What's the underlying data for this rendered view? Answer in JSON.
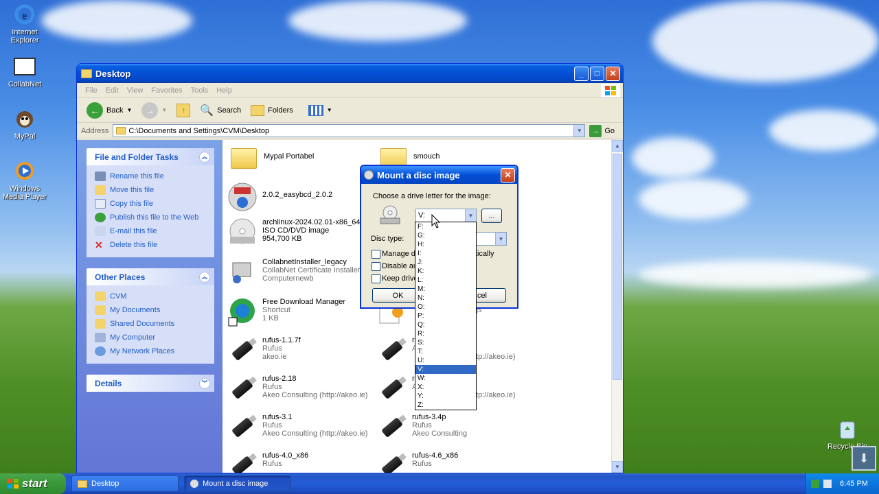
{
  "desktop": {
    "icons": [
      {
        "label": "Internet Explorer"
      },
      {
        "label": "CollabNet"
      },
      {
        "label": "MyPal"
      },
      {
        "label": "Windows Media Player"
      },
      {
        "label": "Recycle Bin"
      }
    ]
  },
  "window": {
    "title": "Desktop",
    "menu": [
      "File",
      "Edit",
      "View",
      "Favorites",
      "Tools",
      "Help"
    ],
    "toolbar": {
      "back": "Back",
      "search": "Search",
      "folders": "Folders"
    },
    "address": {
      "label": "Address",
      "value": "C:\\Documents and Settings\\CVM\\Desktop",
      "go": "Go"
    },
    "tasks_panel": {
      "title": "File and Folder Tasks",
      "items": [
        "Rename this file",
        "Move this file",
        "Copy this file",
        "Publish this file to the Web",
        "E-mail this file",
        "Delete this file"
      ]
    },
    "places_panel": {
      "title": "Other Places",
      "items": [
        "CVM",
        "My Documents",
        "Shared Documents",
        "My Computer",
        "My Network Places"
      ]
    },
    "details_panel": {
      "title": "Details"
    },
    "files": [
      {
        "name": "Mypal Portabel",
        "l2": "",
        "l3": ""
      },
      {
        "name": "smouch",
        "l2": "",
        "l3": ""
      },
      {
        "name": "2.0.2_easybcd_2.0.2",
        "l2": "",
        "l3": ""
      },
      {
        "name": "archlinux-2024.02.01-x86_64",
        "l2": "ISO CD/DVD image",
        "l3": "954,700 KB"
      },
      {
        "name": "CollabnetInstaller_legacy",
        "l2": "CollabNet Certificate Installer",
        "l3": "Computernewb"
      },
      {
        "name": "Free Download Manager",
        "l2": "Shortcut",
        "l3": "1 KB"
      },
      {
        "name": "rufus-1.1.7f",
        "l2": "Rufus",
        "l3": "akeo.ie"
      },
      {
        "name": "rufus-2.18",
        "l2": "Rufus",
        "l3": "Akeo Consulting (http://akeo.ie)"
      },
      {
        "name": "rufus-3.1",
        "l2": "Rufus",
        "l3": "Akeo Consulting (http://akeo.ie)"
      },
      {
        "name": "rufus-3.4p",
        "l2": "Rufus",
        "l3": "Akeo Consulting"
      },
      {
        "name": "rufus-4.0_x86",
        "l2": "Rufus",
        "l3": ""
      },
      {
        "name": "rufus-4.6_x86",
        "l2": "Rufus",
        "l3": ""
      }
    ],
    "partial_texts": {
      "settings_tail": "gs",
      "akeo_tail1": "ttp://akeo.ie)",
      "akeo_tail2": "ttp://akeo.ie)",
      "r1": "r",
      "a1": "A",
      "r2": "r",
      "a2": "A"
    }
  },
  "dialog": {
    "title": "Mount a disc image",
    "prompt": "Choose a drive letter for the image:",
    "drive_value": "V:",
    "browse": "...",
    "disc_type_label": "Disc type:",
    "checkboxes": [
      "Manage d",
      "Disable au",
      "Keep drive"
    ],
    "manage_tail": "tically",
    "ok": "OK",
    "cancel_tail": "cel",
    "drive_options": [
      "F:",
      "G:",
      "H:",
      "I:",
      "J:",
      "K:",
      "L:",
      "M:",
      "N:",
      "O:",
      "P:",
      "Q:",
      "R:",
      "S:",
      "T:",
      "U:",
      "V:",
      "W:",
      "X:",
      "Y:",
      "Z:"
    ],
    "selected_option": "V:"
  },
  "taskbar": {
    "start": "start",
    "tasks": [
      "Desktop",
      "Mount a disc image"
    ],
    "clock": "6:45 PM"
  },
  "colors": {
    "accent": "#0450d6",
    "selected": "#316ac5",
    "link": "#215dc6"
  }
}
